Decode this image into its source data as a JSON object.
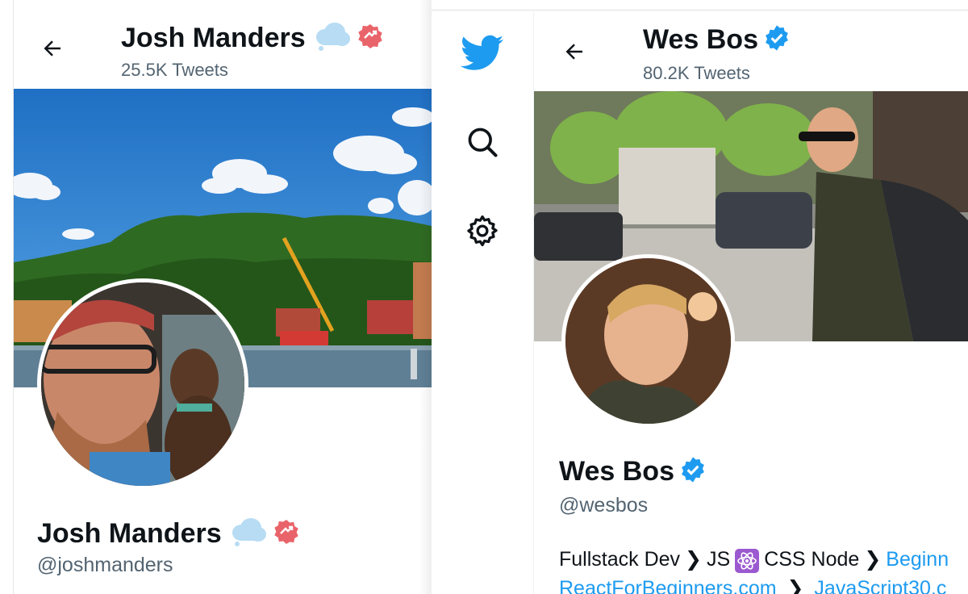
{
  "left_profile": {
    "header_name": "Josh Manders",
    "tweet_count": "25.5K Tweets",
    "display_name": "Josh Manders",
    "handle": "@joshmanders"
  },
  "right_profile": {
    "header_name": "Wes Bos",
    "tweet_count": "80.2K Tweets",
    "display_name": "Wes Bos",
    "handle": "@wesbos",
    "bio": {
      "part1": "Fullstack Dev",
      "part2": "JS",
      "part3": "CSS Node",
      "link1": "Beginn",
      "link2": "ReactForBeginners.com",
      "link3": "JavaScript30.c"
    }
  },
  "icons": {
    "back": "arrow-left-icon",
    "cloud_emoji": "cloud-emoji-icon",
    "badge": "red-badge-icon",
    "verified": "verified-badge-icon",
    "twitter_logo": "twitter-bird-icon",
    "search": "search-icon",
    "settings": "gear-icon",
    "react": "react-atom-emoji-icon"
  },
  "colors": {
    "twitter_blue": "#1d9bf0",
    "badge_red": "#e9646a",
    "cloud_blue": "#b7dcf4",
    "text_primary": "#0f1419",
    "text_secondary": "#536471"
  }
}
